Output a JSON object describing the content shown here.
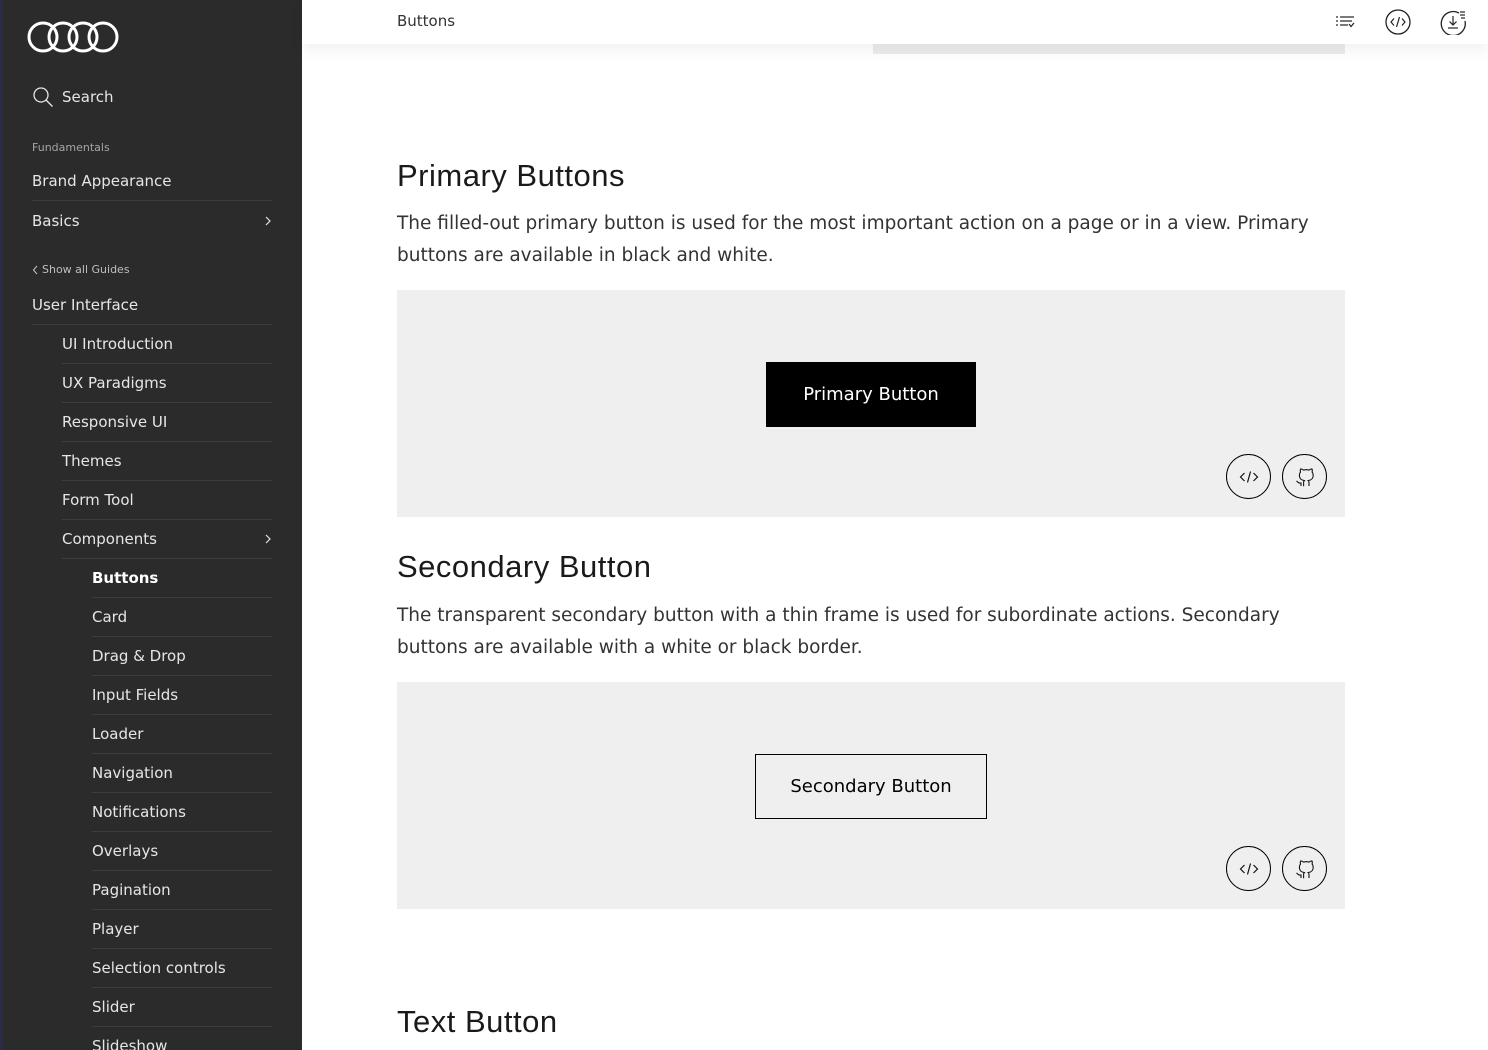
{
  "sidebar": {
    "search_label": "Search",
    "fundamentals_label": "Fundamentals",
    "brand_appearance": "Brand Appearance",
    "basics": "Basics",
    "show_all_guides": "Show all Guides",
    "user_interface": "User Interface",
    "ui_items": [
      "UI Introduction",
      "UX Paradigms",
      "Responsive UI",
      "Themes",
      "Form Tool",
      "Components"
    ],
    "components": [
      "Buttons",
      "Card",
      "Drag & Drop",
      "Input Fields",
      "Loader",
      "Navigation",
      "Notifications",
      "Overlays",
      "Pagination",
      "Player",
      "Selection controls",
      "Slider",
      "Slideshow"
    ],
    "active_item": "Buttons"
  },
  "header": {
    "title": "Buttons",
    "icons": [
      "list-icon",
      "code-icon",
      "download-icon"
    ]
  },
  "sections": {
    "primary": {
      "title": "Primary Buttons",
      "description": "The filled-out primary button is used for the most important action on a page or in a view. Primary buttons are available in black and white.",
      "button_label": "Primary Button"
    },
    "secondary": {
      "title": "Secondary Button",
      "description": "The transparent secondary button with a thin frame is used for subordinate actions. Secondary buttons are available with a white or black border.",
      "button_label": "Secondary Button"
    },
    "text": {
      "title": "Text Button"
    }
  },
  "colors": {
    "sidebar_bg": "#2b2b2b",
    "demo_bg": "#efefef",
    "primary_btn": "#000000"
  }
}
